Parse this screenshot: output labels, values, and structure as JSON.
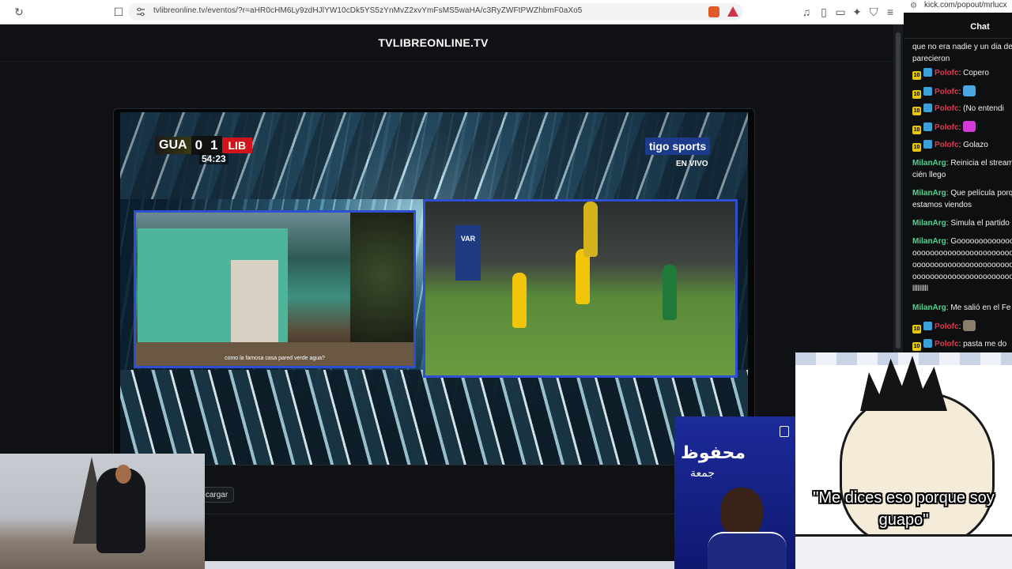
{
  "browser": {
    "url": "tvlibreonline.tv/eventos/?r=aHR0cHM6Ly9zdHJlYW10cDk5YS5zYnMvZ2xvYmFsMS5waHA/c3RyZWFtPWZhbmF0aXo5",
    "icons": [
      "refresh-icon",
      "bookmark-icon",
      "site-settings-icon",
      "music-icon",
      "sidebar-icon",
      "wallet-icon",
      "extensions-icon",
      "shield-icon",
      "menu-icon"
    ]
  },
  "popout": {
    "url": "kick.com/popout/mrlucx",
    "chat_title": "Chat",
    "messages": [
      {
        "user": "",
        "text": "que no era nadie y un dia desaparecieron",
        "badges": false
      },
      {
        "user": "Polofc",
        "text": ": Copero",
        "badges": true
      },
      {
        "user": "Polofc",
        "text": ":",
        "badges": true,
        "emote": "#4aa7e6"
      },
      {
        "user": "Polofc",
        "text": ": (No entendi",
        "badges": true
      },
      {
        "user": "Polofc",
        "text": ":",
        "badges": true,
        "emote": "#d23ad8"
      },
      {
        "user": "Polofc",
        "text": ": Golazo",
        "badges": true
      },
      {
        "user": "MilanArg",
        "text": ": Reinicia el stream recién llego",
        "badges": false
      },
      {
        "user": "MilanArg",
        "text": ": Que película porque estamos viendos",
        "badges": false
      },
      {
        "user": "MilanArg",
        "text": ": Simula el partido",
        "badges": false
      },
      {
        "user": "MilanArg",
        "text": ": Goooooooooooooooooooooooooooooooooooooooooooooooooooooooooooooooooooooooooooooooooooooooooolllllllll",
        "badges": false
      },
      {
        "user": "MilanArg",
        "text": ": Me salió en el Fe",
        "badges": false
      },
      {
        "user": "Polofc",
        "text": ":",
        "badges": true,
        "emote": "#8a7d6a"
      },
      {
        "user": "Polofc",
        "text": ": pasta me do",
        "badges": true
      }
    ]
  },
  "site": {
    "brand": "TVLIBREONLINE.TV",
    "download_label": "cargar"
  },
  "broadcast": {
    "home": "GUA",
    "home_score": "0",
    "away_score": "1",
    "away": "LIB",
    "clock": "54:23",
    "network": "tigo sports",
    "live": "EN VIVO",
    "var": "VAR",
    "caption": "como la famosa casa pared verde agua?"
  },
  "overlays": {
    "cartoon_caption_line1": "\"Me dices eso porque soy",
    "cartoon_caption_line2": "guapo\"",
    "poster_title": "محفوظ",
    "poster_subtitle": "جمعة"
  },
  "colors": {
    "accent_blue": "#2e4fd1",
    "polofc": "#e2384f",
    "milanarg": "#4fd38f",
    "lib_red": "#d0141e"
  }
}
